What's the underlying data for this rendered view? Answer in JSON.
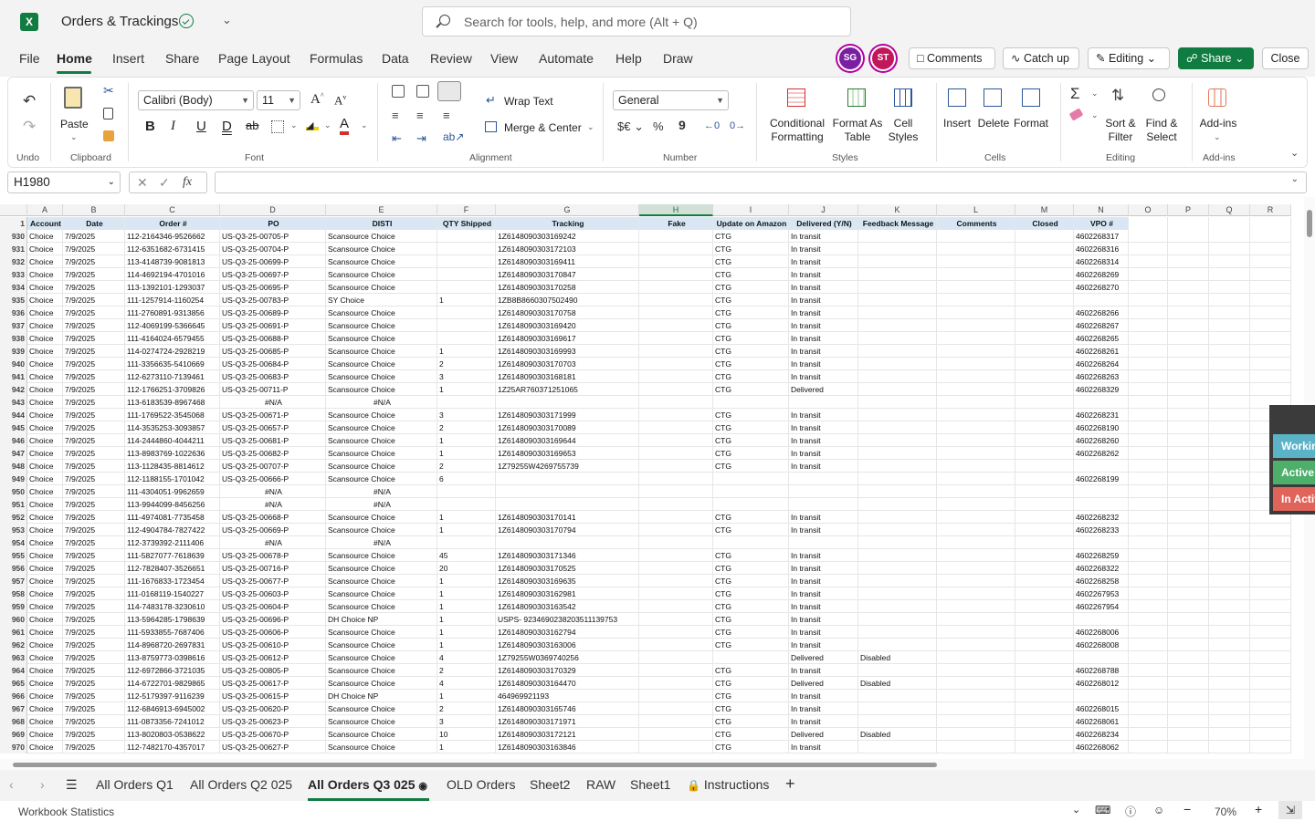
{
  "app": {
    "title": "Orders & Trackings",
    "search_placeholder": "Search for tools, help, and more (Alt + Q)",
    "logo_letter": "X"
  },
  "menu": {
    "items": [
      "File",
      "Home",
      "Insert",
      "Share",
      "Page Layout",
      "Formulas",
      "Data",
      "Review",
      "View",
      "Automate",
      "Help",
      "Draw"
    ],
    "active": "Home"
  },
  "collab": {
    "avatars": [
      {
        "initials": "SG",
        "color": "#7b1fa2"
      },
      {
        "initials": "ST",
        "color": "#c2185b"
      }
    ],
    "comments": "Comments",
    "catch_up": "Catch up",
    "editing": "Editing",
    "share": "Share",
    "close": "Close"
  },
  "ribbon": {
    "groups": {
      "undo": "Undo",
      "clipboard": "Clipboard",
      "font": "Font",
      "alignment": "Alignment",
      "number": "Number",
      "styles": "Styles",
      "cells": "Cells",
      "editing": "Editing",
      "addins": "Add-ins"
    },
    "paste": "Paste",
    "font_name": "Calibri (Body)",
    "font_size": "11",
    "wrap_text": "Wrap Text",
    "merge_center": "Merge & Center",
    "number_format": "General",
    "conditional_formatting": "Conditional\nFormatting",
    "format_as_table": "Format As\nTable",
    "cell_styles": "Cell\nStyles",
    "insert": "Insert",
    "delete": "Delete",
    "format": "Format",
    "sort_filter": "Sort &\nFilter",
    "find_select": "Find &\nSelect",
    "addins": "Add-ins"
  },
  "formula_bar": {
    "name_box": "H1980",
    "fx": "fx",
    "content": ""
  },
  "grid": {
    "selected_column": "H",
    "columns": [
      "A",
      "B",
      "C",
      "D",
      "E",
      "F",
      "G",
      "H",
      "I",
      "J",
      "K",
      "L",
      "M",
      "N",
      "O",
      "P",
      "Q",
      "R"
    ],
    "header_row_number": "1",
    "headers": [
      "Account",
      "Date",
      "Order #",
      "PO",
      "DISTI",
      "QTY Shipped",
      "Tracking",
      "Fake",
      "Update on Amazon",
      "Delivered (Y/N)",
      "Feedback Message",
      "Comments",
      "Closed",
      "VPO #"
    ],
    "rows": [
      [
        "930",
        "Choice",
        "7/9/2025",
        "112-2164346-9526662",
        "US-Q3-25-00705-P",
        "Scansource Choice",
        "",
        "1Z6148090303169242",
        "",
        "CTG",
        "In transit",
        "",
        "",
        "",
        "4602268317"
      ],
      [
        "931",
        "Choice",
        "7/9/2025",
        "112-6351682-6731415",
        "US-Q3-25-00704-P",
        "Scansource Choice",
        "",
        "1Z6148090303172103",
        "",
        "CTG",
        "In transit",
        "",
        "",
        "",
        "4602268316"
      ],
      [
        "932",
        "Choice",
        "7/9/2025",
        "113-4148739-9081813",
        "US-Q3-25-00699-P",
        "Scansource Choice",
        "",
        "1Z6148090303169411",
        "",
        "CTG",
        "In transit",
        "",
        "",
        "",
        "4602268314"
      ],
      [
        "933",
        "Choice",
        "7/9/2025",
        "114-4692194-4701016",
        "US-Q3-25-00697-P",
        "Scansource Choice",
        "",
        "1Z6148090303170847",
        "",
        "CTG",
        "In transit",
        "",
        "",
        "",
        "4602268269"
      ],
      [
        "934",
        "Choice",
        "7/9/2025",
        "113-1392101-1293037",
        "US-Q3-25-00695-P",
        "Scansource Choice",
        "",
        "1Z6148090303170258",
        "",
        "CTG",
        "In transit",
        "",
        "",
        "",
        "4602268270"
      ],
      [
        "935",
        "Choice",
        "7/9/2025",
        "111-1257914-1160254",
        "US-Q3-25-00783-P",
        "SY Choice",
        "1",
        "1ZB8B8660307502490",
        "",
        "CTG",
        "In transit",
        "",
        "",
        "",
        ""
      ],
      [
        "936",
        "Choice",
        "7/9/2025",
        "111-2760891-9313856",
        "US-Q3-25-00689-P",
        "Scansource Choice",
        "",
        "1Z6148090303170758",
        "",
        "CTG",
        "In transit",
        "",
        "",
        "",
        "4602268266"
      ],
      [
        "937",
        "Choice",
        "7/9/2025",
        "112-4069199-5366645",
        "US-Q3-25-00691-P",
        "Scansource Choice",
        "",
        "1Z6148090303169420",
        "",
        "CTG",
        "In transit",
        "",
        "",
        "",
        "4602268267"
      ],
      [
        "938",
        "Choice",
        "7/9/2025",
        "111-4164024-6579455",
        "US-Q3-25-00688-P",
        "Scansource Choice",
        "",
        "1Z6148090303169617",
        "",
        "CTG",
        "In transit",
        "",
        "",
        "",
        "4602268265"
      ],
      [
        "939",
        "Choice",
        "7/9/2025",
        "114-0274724-2928219",
        "US-Q3-25-00685-P",
        "Scansource Choice",
        "1",
        "1Z6148090303169993",
        "",
        "CTG",
        "In transit",
        "",
        "",
        "",
        "4602268261"
      ],
      [
        "940",
        "Choice",
        "7/9/2025",
        "111-3356635-5410669",
        "US-Q3-25-00684-P",
        "Scansource Choice",
        "2",
        "1Z6148090303170703",
        "",
        "CTG",
        "In transit",
        "",
        "",
        "",
        "4602268264"
      ],
      [
        "941",
        "Choice",
        "7/9/2025",
        "112-6273110-7139461",
        "US-Q3-25-00683-P",
        "Scansource Choice",
        "3",
        "1Z6148090303168181",
        "",
        "CTG",
        "In transit",
        "",
        "",
        "",
        "4602268263"
      ],
      [
        "942",
        "Choice",
        "7/9/2025",
        "112-1766251-3709826",
        "US-Q3-25-00711-P",
        "Scansource Choice",
        "1",
        "1Z25AR760371251065",
        "",
        "CTG",
        "Delivered",
        "",
        "",
        "",
        "4602268329"
      ],
      [
        "943",
        "Choice",
        "7/9/2025",
        "113-6183539-8967468",
        "#N/A",
        "#N/A",
        "",
        "",
        "",
        "",
        "",
        "",
        "",
        "",
        ""
      ],
      [
        "944",
        "Choice",
        "7/9/2025",
        "111-1769522-3545068",
        "US-Q3-25-00671-P",
        "Scansource Choice",
        "3",
        "1Z6148090303171999",
        "",
        "CTG",
        "In transit",
        "",
        "",
        "",
        "4602268231"
      ],
      [
        "945",
        "Choice",
        "7/9/2025",
        "114-3535253-3093857",
        "US-Q3-25-00657-P",
        "Scansource Choice",
        "2",
        "1Z6148090303170089",
        "",
        "CTG",
        "In transit",
        "",
        "",
        "",
        "4602268190"
      ],
      [
        "946",
        "Choice",
        "7/9/2025",
        "114-2444860-4044211",
        "US-Q3-25-00681-P",
        "Scansource Choice",
        "1",
        "1Z6148090303169644",
        "",
        "CTG",
        "In transit",
        "",
        "",
        "",
        "4602268260"
      ],
      [
        "947",
        "Choice",
        "7/9/2025",
        "113-8983769-1022636",
        "US-Q3-25-00682-P",
        "Scansource Choice",
        "1",
        "1Z6148090303169653",
        "",
        "CTG",
        "In transit",
        "",
        "",
        "",
        "4602268262"
      ],
      [
        "948",
        "Choice",
        "7/9/2025",
        "113-1128435-8814612",
        "US-Q3-25-00707-P",
        "Scansource Choice",
        "2",
        "1Z79255W4269755739",
        "",
        "CTG",
        "In transit",
        "",
        "",
        "",
        ""
      ],
      [
        "949",
        "Choice",
        "7/9/2025",
        "112-1188155-1701042",
        "US-Q3-25-00666-P",
        "Scansource Choice",
        "6",
        "",
        "",
        "",
        "",
        "",
        "",
        "",
        "4602268199"
      ],
      [
        "950",
        "Choice",
        "7/9/2025",
        "111-4304051-9962659",
        "#N/A",
        "#N/A",
        "",
        "",
        "",
        "",
        "",
        "",
        "",
        "",
        ""
      ],
      [
        "951",
        "Choice",
        "7/9/2025",
        "113-9944099-8456256",
        "#N/A",
        "#N/A",
        "",
        "",
        "",
        "",
        "",
        "",
        "",
        "",
        ""
      ],
      [
        "952",
        "Choice",
        "7/9/2025",
        "111-4974081-7735458",
        "US-Q3-25-00668-P",
        "Scansource Choice",
        "1",
        "1Z6148090303170141",
        "",
        "CTG",
        "In transit",
        "",
        "",
        "",
        "4602268232"
      ],
      [
        "953",
        "Choice",
        "7/9/2025",
        "112-4904784-7827422",
        "US-Q3-25-00669-P",
        "Scansource Choice",
        "1",
        "1Z6148090303170794",
        "",
        "CTG",
        "In transit",
        "",
        "",
        "",
        "4602268233"
      ],
      [
        "954",
        "Choice",
        "7/9/2025",
        "112-3739392-2111406",
        "#N/A",
        "#N/A",
        "",
        "",
        "",
        "",
        "",
        "",
        "",
        "",
        ""
      ],
      [
        "955",
        "Choice",
        "7/9/2025",
        "111-5827077-7618639",
        "US-Q3-25-00678-P",
        "Scansource Choice",
        "45",
        "1Z6148090303171346",
        "",
        "CTG",
        "In transit",
        "",
        "",
        "",
        "4602268259"
      ],
      [
        "956",
        "Choice",
        "7/9/2025",
        "112-7828407-3526651",
        "US-Q3-25-00716-P",
        "Scansource Choice",
        "20",
        "1Z6148090303170525",
        "",
        "CTG",
        "In transit",
        "",
        "",
        "",
        "4602268322"
      ],
      [
        "957",
        "Choice",
        "7/9/2025",
        "111-1676833-1723454",
        "US-Q3-25-00677-P",
        "Scansource Choice",
        "1",
        "1Z6148090303169635",
        "",
        "CTG",
        "In transit",
        "",
        "",
        "",
        "4602268258"
      ],
      [
        "958",
        "Choice",
        "7/9/2025",
        "111-0168119-1540227",
        "US-Q3-25-00603-P",
        "Scansource Choice",
        "1",
        "1Z6148090303162981",
        "",
        "CTG",
        "In transit",
        "",
        "",
        "",
        "4602267953"
      ],
      [
        "959",
        "Choice",
        "7/9/2025",
        "114-7483178-3230610",
        "US-Q3-25-00604-P",
        "Scansource Choice",
        "1",
        "1Z6148090303163542",
        "",
        "CTG",
        "In transit",
        "",
        "",
        "",
        "4602267954"
      ],
      [
        "960",
        "Choice",
        "7/9/2025",
        "113-5964285-1798639",
        "US-Q3-25-00696-P",
        "DH Choice NP",
        "1",
        "USPS- 9234690238203511139753",
        "",
        "CTG",
        "In transit",
        "",
        "",
        "",
        ""
      ],
      [
        "961",
        "Choice",
        "7/9/2025",
        "111-5933855-7687406",
        "US-Q3-25-00606-P",
        "Scansource Choice",
        "1",
        "1Z6148090303162794",
        "",
        "CTG",
        "In transit",
        "",
        "",
        "",
        "4602268006"
      ],
      [
        "962",
        "Choice",
        "7/9/2025",
        "114-8968720-2697831",
        "US-Q3-25-00610-P",
        "Scansource Choice",
        "1",
        "1Z6148090303163006",
        "",
        "CTG",
        "In transit",
        "",
        "",
        "",
        "4602268008"
      ],
      [
        "963",
        "Choice",
        "7/9/2025",
        "113-8759773-0398616",
        "US-Q3-25-00612-P",
        "Scansource Choice",
        "4",
        "1Z79255W0369740256",
        "",
        "",
        "Delivered",
        "Disabled",
        "",
        "",
        ""
      ],
      [
        "964",
        "Choice",
        "7/9/2025",
        "112-6972866-3721035",
        "US-Q3-25-00805-P",
        "Scansource Choice",
        "2",
        "1Z6148090303170329",
        "",
        "CTG",
        "In transit",
        "",
        "",
        "",
        "4602268788"
      ],
      [
        "965",
        "Choice",
        "7/9/2025",
        "114-6722701-9829865",
        "US-Q3-25-00617-P",
        "Scansource Choice",
        "4",
        "1Z6148090303164470",
        "",
        "CTG",
        "Delivered",
        "Disabled",
        "",
        "",
        "4602268012"
      ],
      [
        "966",
        "Choice",
        "7/9/2025",
        "112-5179397-9116239",
        "US-Q3-25-00615-P",
        "DH Choice NP",
        "1",
        "464969921193",
        "",
        "CTG",
        "In transit",
        "",
        "",
        "",
        ""
      ],
      [
        "967",
        "Choice",
        "7/9/2025",
        "112-6846913-6945002",
        "US-Q3-25-00620-P",
        "Scansource Choice",
        "2",
        "1Z6148090303165746",
        "",
        "CTG",
        "In transit",
        "",
        "",
        "",
        "4602268015"
      ],
      [
        "968",
        "Choice",
        "7/9/2025",
        "111-0873356-7241012",
        "US-Q3-25-00623-P",
        "Scansource Choice",
        "3",
        "1Z6148090303171971",
        "",
        "CTG",
        "In transit",
        "",
        "",
        "",
        "4602268061"
      ],
      [
        "969",
        "Choice",
        "7/9/2025",
        "113-8020803-0538622",
        "US-Q3-25-00670-P",
        "Scansource Choice",
        "10",
        "1Z6148090303172121",
        "",
        "CTG",
        "Delivered",
        "Disabled",
        "",
        "",
        "4602268234"
      ],
      [
        "970",
        "Choice",
        "7/9/2025",
        "112-7482170-4357017",
        "US-Q3-25-00627-P",
        "Scansource Choice",
        "1",
        "1Z6148090303163846",
        "",
        "CTG",
        "In transit",
        "",
        "",
        "",
        "4602268062"
      ]
    ]
  },
  "side_panel": [
    {
      "label": "Working",
      "color": "#5bb3c8"
    },
    {
      "label": "Active",
      "color": "#4caf6a"
    },
    {
      "label": "In Active",
      "color": "#e0645a"
    }
  ],
  "sheets": {
    "tabs": [
      "All Orders Q1",
      "All Orders Q2 025",
      "All Orders Q3 025",
      "OLD Orders",
      "Sheet2",
      "RAW",
      "Sheet1",
      "Instructions"
    ],
    "active": "All Orders Q3 025"
  },
  "status": {
    "left": "Workbook Statistics",
    "zoom": "70%"
  }
}
